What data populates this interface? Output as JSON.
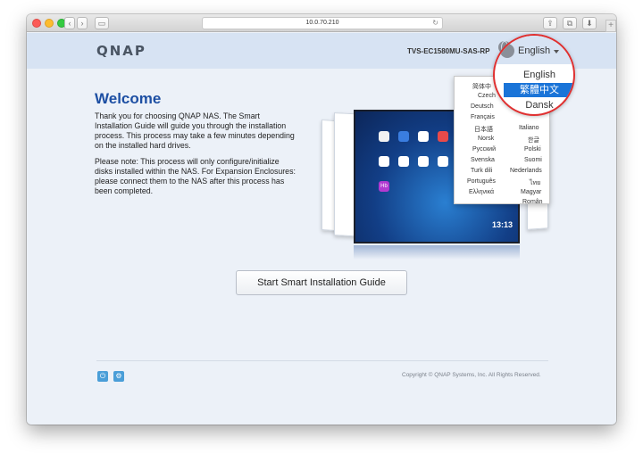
{
  "browser": {
    "url": "10.0.70.210",
    "nav_back": "‹",
    "nav_forward": "›",
    "sidebar": "▭",
    "reload": "↻",
    "share": "⇪",
    "tabs": "⧉",
    "download": "⬇",
    "new_tab": "+"
  },
  "header": {
    "logo": "QNAP",
    "model": "TVS-EC1580MU-SAS-RP",
    "language": "English"
  },
  "welcome": {
    "title": "Welcome",
    "text": "Thank you for choosing QNAP NAS. The Smart Installation Guide will guide you through the installation process. This process may take a few minutes depending on the installed hard drives.",
    "note": "Please note: This process will only configure/initialize disks installed within the NAS. For Expansion Enclosures: please connect them to the NAS after this process has been completed."
  },
  "illustration": {
    "clock": "13:13",
    "badge": "Hb"
  },
  "language_menu": {
    "items": [
      "简体中",
      "Czech",
      "Deutsch",
      "Français",
      "日本語",
      "Norsk",
      "Русский",
      "Svenska",
      "Turk dili",
      "Português",
      "Ελληνικά",
      "Italiano",
      "한글",
      "Polski",
      "Suomi",
      "Nederlands",
      "ไทย",
      "Magyar",
      "Român"
    ],
    "zoom_items": [
      "English",
      "繁體中文",
      "Dansk"
    ]
  },
  "actions": {
    "start": "Start Smart Installation Guide"
  },
  "footer": {
    "power_icon": "⏻",
    "settings_icon": "⚙",
    "copyright": "Copyright © QNAP Systems, Inc. All Rights Reserved."
  },
  "colors": {
    "accent": "#1a74d8",
    "title": "#1d4fa3",
    "highlight_ring": "#e03030"
  }
}
